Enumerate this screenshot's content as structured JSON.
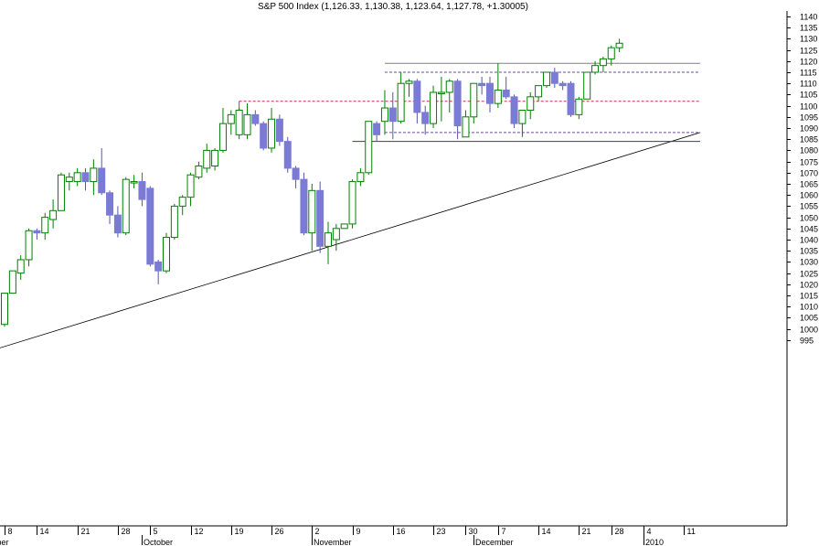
{
  "chart_data": {
    "type": "candlestick",
    "title": "S&P 500 Index (1,126.33, 1,130.38, 1,123.64, 1,127.78, +1.30005)",
    "ylim": [
      990,
      1145
    ],
    "y_ticks": [
      995,
      1000,
      1005,
      1010,
      1015,
      1020,
      1025,
      1030,
      1035,
      1040,
      1045,
      1050,
      1055,
      1060,
      1065,
      1070,
      1075,
      1080,
      1085,
      1090,
      1095,
      1100,
      1105,
      1110,
      1115,
      1120,
      1125,
      1130,
      1135,
      1140
    ],
    "x_ticks": [
      {
        "i": 0,
        "label": "8"
      },
      {
        "i": 4,
        "label": "14"
      },
      {
        "i": 9,
        "label": "21"
      },
      {
        "i": 14,
        "label": "28"
      },
      {
        "i": 18,
        "label": "5"
      },
      {
        "i": 23,
        "label": "12"
      },
      {
        "i": 28,
        "label": "19"
      },
      {
        "i": 33,
        "label": "26"
      },
      {
        "i": 38,
        "label": "2"
      },
      {
        "i": 43,
        "label": "9"
      },
      {
        "i": 48,
        "label": "16"
      },
      {
        "i": 53,
        "label": "23"
      },
      {
        "i": 57,
        "label": "30"
      },
      {
        "i": 61,
        "label": "7"
      },
      {
        "i": 66,
        "label": "14"
      },
      {
        "i": 71,
        "label": "21"
      },
      {
        "i": 75,
        "label": "28"
      },
      {
        "i": 79,
        "label": "4"
      },
      {
        "i": 84,
        "label": "11"
      }
    ],
    "month_labels": [
      {
        "i": -2,
        "label": "mber"
      },
      {
        "i": 17,
        "label": "October"
      },
      {
        "i": 38,
        "label": "November"
      },
      {
        "i": 58,
        "label": "December"
      },
      {
        "i": 79,
        "label": "2010"
      }
    ],
    "candles": [
      {
        "o": 1002,
        "h": 1016,
        "l": 1001,
        "c": 1016
      },
      {
        "o": 1016,
        "h": 1026,
        "l": 1016,
        "c": 1026
      },
      {
        "o": 1025,
        "h": 1033,
        "l": 1022,
        "c": 1031
      },
      {
        "o": 1031,
        "h": 1045,
        "l": 1028,
        "c": 1044
      },
      {
        "o": 1044,
        "h": 1045,
        "l": 1040,
        "c": 1043
      },
      {
        "o": 1043,
        "h": 1052,
        "l": 1040,
        "c": 1050
      },
      {
        "o": 1049,
        "h": 1058,
        "l": 1045,
        "c": 1053
      },
      {
        "o": 1053,
        "h": 1070,
        "l": 1053,
        "c": 1069
      },
      {
        "o": 1066,
        "h": 1070,
        "l": 1062,
        "c": 1068
      },
      {
        "o": 1066,
        "h": 1072,
        "l": 1064,
        "c": 1070
      },
      {
        "o": 1070,
        "h": 1072,
        "l": 1062,
        "c": 1066
      },
      {
        "o": 1066,
        "h": 1076,
        "l": 1060,
        "c": 1072
      },
      {
        "o": 1072,
        "h": 1081,
        "l": 1060,
        "c": 1061
      },
      {
        "o": 1061,
        "h": 1062,
        "l": 1047,
        "c": 1051
      },
      {
        "o": 1051,
        "h": 1055,
        "l": 1041,
        "c": 1043
      },
      {
        "o": 1043,
        "h": 1068,
        "l": 1042,
        "c": 1067
      },
      {
        "o": 1066,
        "h": 1069,
        "l": 1063,
        "c": 1066
      },
      {
        "o": 1066,
        "h": 1070,
        "l": 1055,
        "c": 1058
      },
      {
        "o": 1063,
        "h": 1064,
        "l": 1028,
        "c": 1029
      },
      {
        "o": 1030,
        "h": 1031,
        "l": 1020,
        "c": 1026
      },
      {
        "o": 1026,
        "h": 1043,
        "l": 1025,
        "c": 1041
      },
      {
        "o": 1041,
        "h": 1056,
        "l": 1040,
        "c": 1055
      },
      {
        "o": 1055,
        "h": 1060,
        "l": 1051,
        "c": 1059
      },
      {
        "o": 1059,
        "h": 1070,
        "l": 1055,
        "c": 1069
      },
      {
        "o": 1068,
        "h": 1075,
        "l": 1067,
        "c": 1073
      },
      {
        "o": 1072,
        "h": 1083,
        "l": 1070,
        "c": 1080
      },
      {
        "o": 1073,
        "h": 1081,
        "l": 1071,
        "c": 1080
      },
      {
        "o": 1080,
        "h": 1099,
        "l": 1079,
        "c": 1092
      },
      {
        "o": 1092,
        "h": 1098,
        "l": 1087,
        "c": 1096
      },
      {
        "o": 1087,
        "h": 1099,
        "l": 1085,
        "c": 1098
      },
      {
        "o": 1087,
        "h": 1101,
        "l": 1085,
        "c": 1096
      },
      {
        "o": 1096,
        "h": 1098,
        "l": 1091,
        "c": 1092
      },
      {
        "o": 1092,
        "h": 1093,
        "l": 1080,
        "c": 1081
      },
      {
        "o": 1081,
        "h": 1099,
        "l": 1079,
        "c": 1094
      },
      {
        "o": 1094,
        "h": 1096,
        "l": 1082,
        "c": 1084
      },
      {
        "o": 1084,
        "h": 1086,
        "l": 1070,
        "c": 1072
      },
      {
        "o": 1072,
        "h": 1073,
        "l": 1063,
        "c": 1067
      },
      {
        "o": 1067,
        "h": 1070,
        "l": 1042,
        "c": 1043
      },
      {
        "o": 1043,
        "h": 1065,
        "l": 1035,
        "c": 1062
      },
      {
        "o": 1062,
        "h": 1066,
        "l": 1034,
        "c": 1037
      },
      {
        "o": 1037,
        "h": 1048,
        "l": 1029,
        "c": 1043
      },
      {
        "o": 1040,
        "h": 1047,
        "l": 1035,
        "c": 1045
      },
      {
        "o": 1045,
        "h": 1047,
        "l": 1045,
        "c": 1047
      },
      {
        "o": 1047,
        "h": 1067,
        "l": 1045,
        "c": 1066
      },
      {
        "o": 1066,
        "h": 1072,
        "l": 1064,
        "c": 1070
      },
      {
        "o": 1070,
        "h": 1093,
        "l": 1069,
        "c": 1093
      },
      {
        "o": 1092,
        "h": 1093,
        "l": 1084,
        "c": 1087
      },
      {
        "o": 1093,
        "h": 1107,
        "l": 1087,
        "c": 1099
      },
      {
        "o": 1099,
        "h": 1106,
        "l": 1085,
        "c": 1093
      },
      {
        "o": 1093,
        "h": 1115,
        "l": 1092,
        "c": 1110
      },
      {
        "o": 1110,
        "h": 1112,
        "l": 1104,
        "c": 1111
      },
      {
        "o": 1111,
        "h": 1112,
        "l": 1092,
        "c": 1097
      },
      {
        "o": 1097,
        "h": 1100,
        "l": 1087,
        "c": 1092
      },
      {
        "o": 1092,
        "h": 1109,
        "l": 1090,
        "c": 1106
      },
      {
        "o": 1106,
        "h": 1113,
        "l": 1093,
        "c": 1106
      },
      {
        "o": 1106,
        "h": 1112,
        "l": 1097,
        "c": 1111
      },
      {
        "o": 1111,
        "h": 1112,
        "l": 1085,
        "c": 1091
      },
      {
        "o": 1086,
        "h": 1098,
        "l": 1086,
        "c": 1095
      },
      {
        "o": 1095,
        "h": 1110,
        "l": 1092,
        "c": 1110
      },
      {
        "o": 1110,
        "h": 1113,
        "l": 1105,
        "c": 1109
      },
      {
        "o": 1110,
        "h": 1113,
        "l": 1097,
        "c": 1101
      },
      {
        "o": 1101,
        "h": 1119,
        "l": 1099,
        "c": 1107
      },
      {
        "o": 1107,
        "h": 1113,
        "l": 1103,
        "c": 1104
      },
      {
        "o": 1104,
        "h": 1105,
        "l": 1090,
        "c": 1092
      },
      {
        "o": 1092,
        "h": 1097,
        "l": 1086,
        "c": 1098
      },
      {
        "o": 1098,
        "h": 1106,
        "l": 1094,
        "c": 1104
      },
      {
        "o": 1104,
        "h": 1109,
        "l": 1102,
        "c": 1109
      },
      {
        "o": 1109,
        "h": 1115,
        "l": 1108,
        "c": 1115
      },
      {
        "o": 1115,
        "h": 1117,
        "l": 1108,
        "c": 1110
      },
      {
        "o": 1110,
        "h": 1111,
        "l": 1107,
        "c": 1109
      },
      {
        "o": 1110,
        "h": 1111,
        "l": 1095,
        "c": 1096
      },
      {
        "o": 1096,
        "h": 1104,
        "l": 1094,
        "c": 1103
      },
      {
        "o": 1103,
        "h": 1115,
        "l": 1103,
        "c": 1115
      },
      {
        "o": 1115,
        "h": 1120,
        "l": 1114,
        "c": 1118
      },
      {
        "o": 1118,
        "h": 1122,
        "l": 1115,
        "c": 1121
      },
      {
        "o": 1121,
        "h": 1127,
        "l": 1118,
        "c": 1126
      },
      {
        "o": 1126,
        "h": 1130,
        "l": 1124,
        "c": 1128
      }
    ],
    "overlays": {
      "trendline": {
        "from": {
          "i": -1,
          "v": 991
        },
        "to": {
          "i": 86,
          "v": 1088
        }
      },
      "support_dark": {
        "from_i": 43,
        "to_i": 86,
        "v": 1084
      },
      "resistance_dark": {
        "from_i": 47,
        "to_i": 86,
        "v": 1119
      },
      "dashed_purple": [
        {
          "from_i": 47,
          "to_i": 86,
          "v": 1115
        },
        {
          "from_i": 47,
          "to_i": 86,
          "v": 1088
        }
      ],
      "dashed_red": {
        "from_i": 29,
        "to_i": 86,
        "v": 1102
      }
    },
    "colors": {
      "up_border": "#008000",
      "down_fill": "#7b7bd6",
      "trendline": "#000000",
      "resistance": "#808080",
      "dashed_purple": "#6a4aa0",
      "dashed_red": "#c03060"
    }
  }
}
